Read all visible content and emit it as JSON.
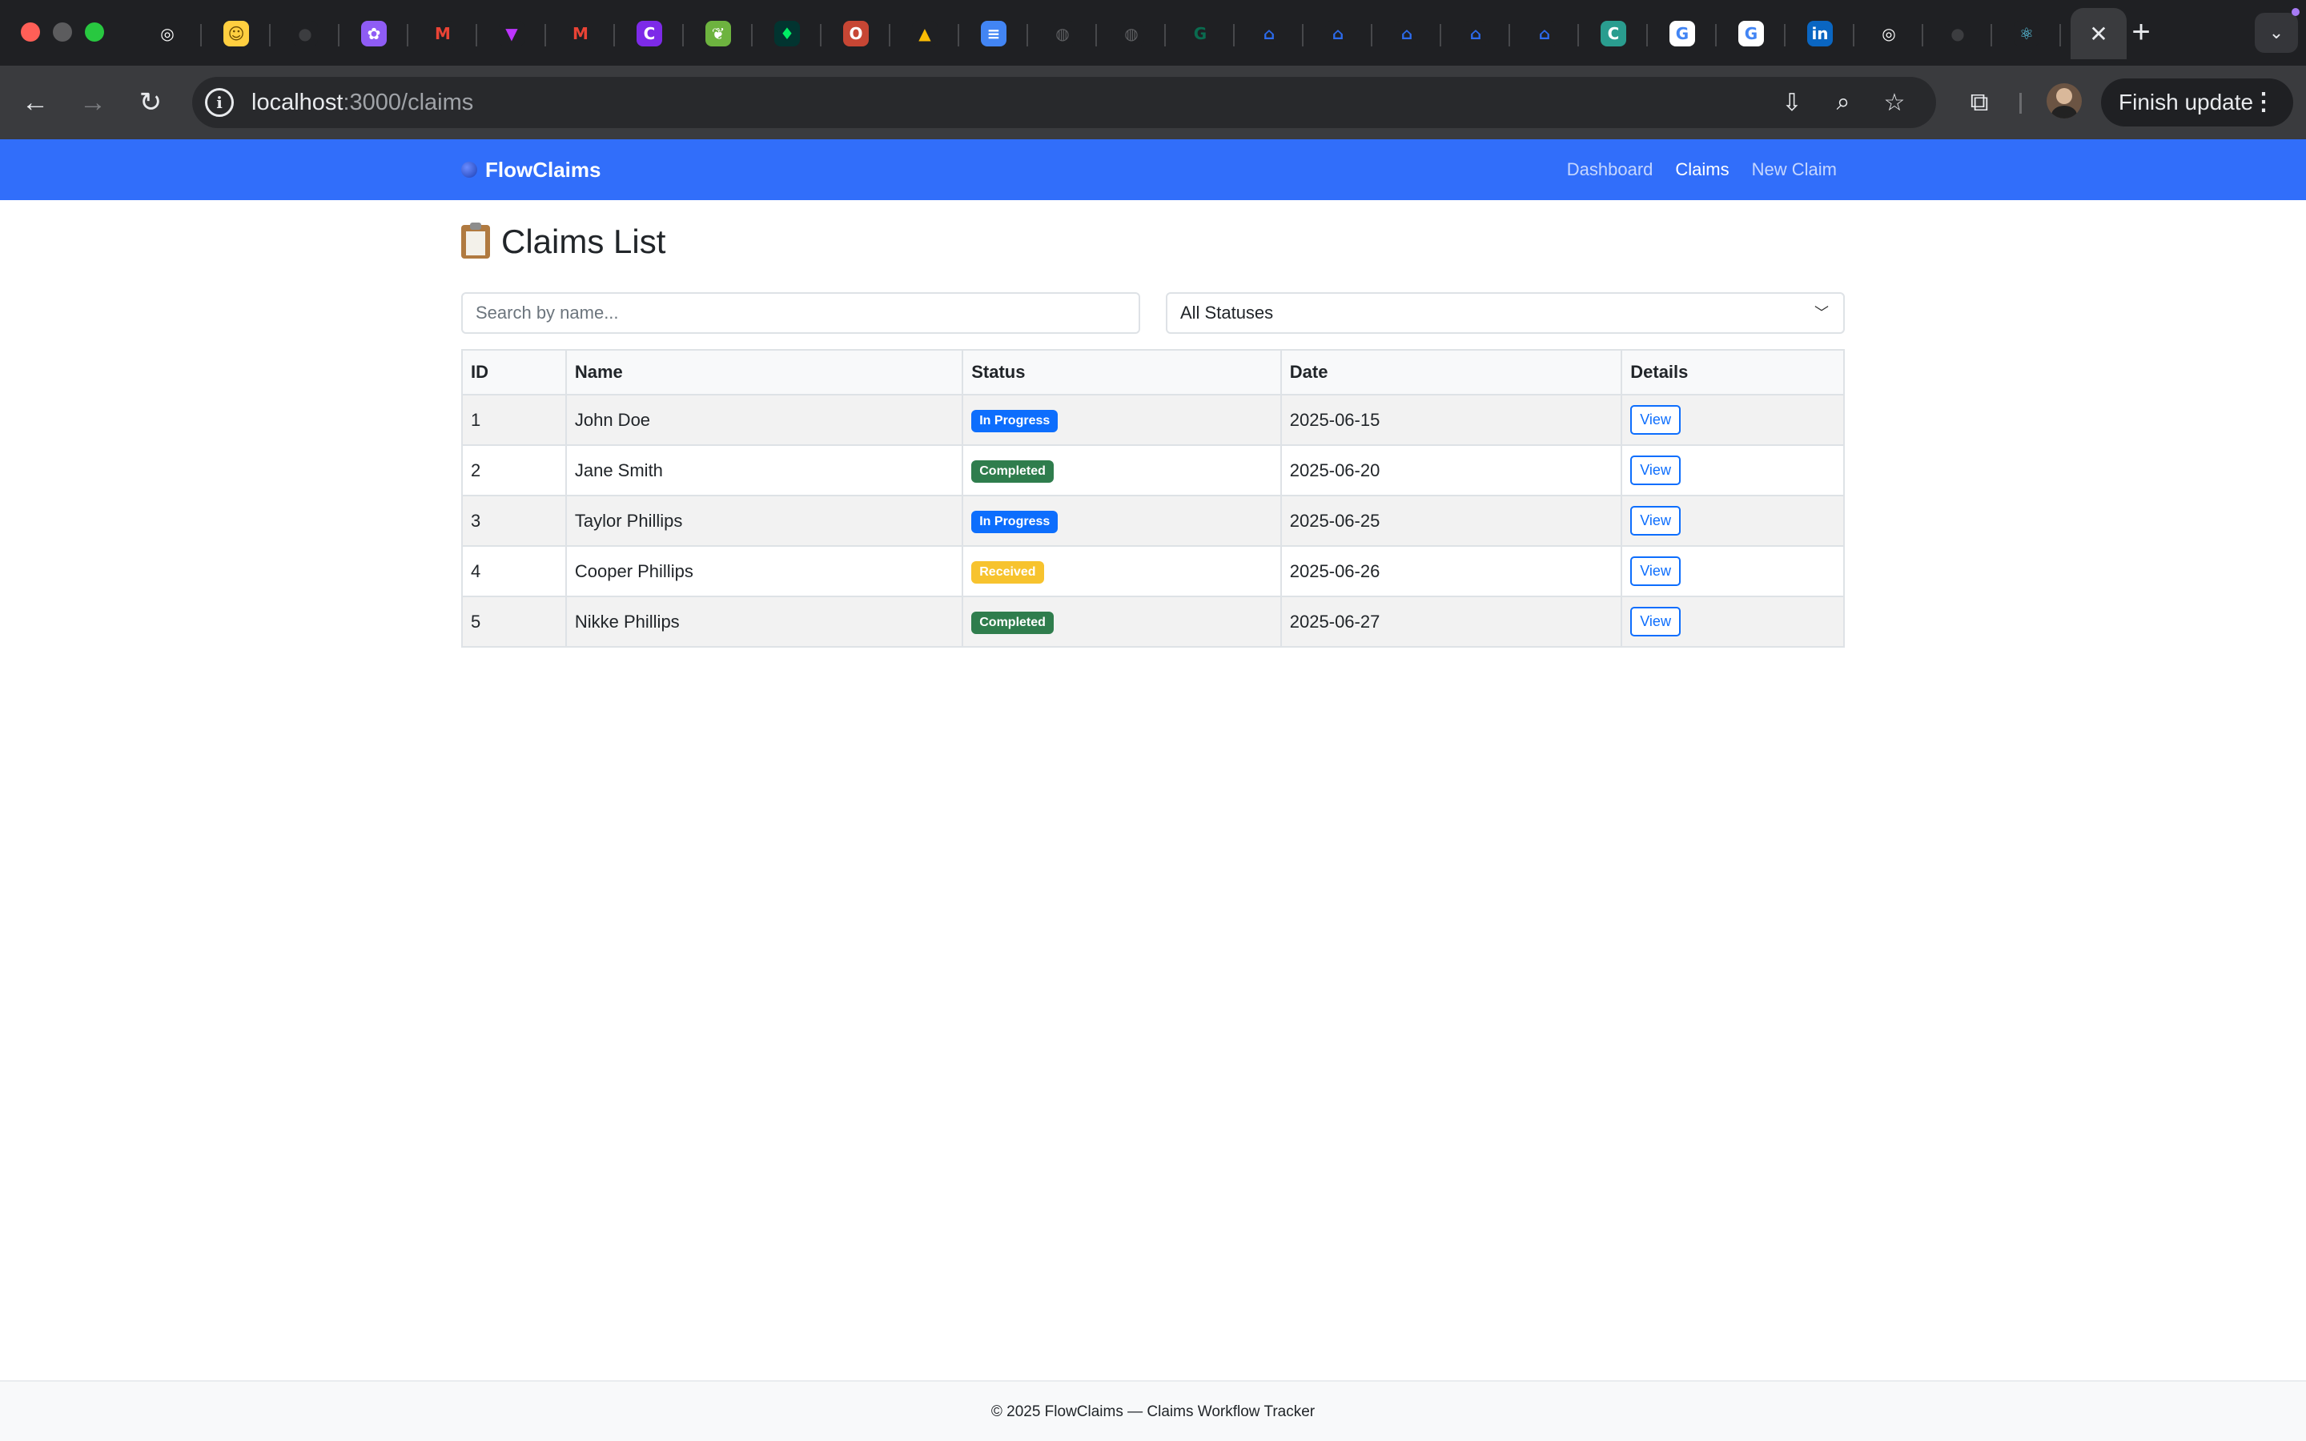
{
  "browser": {
    "tabs": [
      {
        "icon": "openai-icon",
        "glyph": "◎",
        "bg": "#1f2023",
        "fg": "#ffffff"
      },
      {
        "icon": "huggingface-icon",
        "glyph": "☺",
        "bg": "#ffcf40",
        "fg": "#6b4a00"
      },
      {
        "icon": "github-icon",
        "glyph": "●",
        "bg": "#1f2023",
        "fg": "#3c3d40"
      },
      {
        "icon": "figjam-icon",
        "glyph": "✿",
        "bg": "#8f5cf5",
        "fg": "#ffffff"
      },
      {
        "icon": "gmail-icon",
        "glyph": "M",
        "bg": "#1f2023",
        "fg": "#ea4335"
      },
      {
        "icon": "vite-icon",
        "glyph": "▼",
        "bg": "#1f2023",
        "fg": "#bd34fe"
      },
      {
        "icon": "gmail-icon",
        "glyph": "M",
        "bg": "#1f2023",
        "fg": "#ea4335"
      },
      {
        "icon": "canva-icon",
        "glyph": "C",
        "bg": "#7d2ae8",
        "fg": "#ffffff"
      },
      {
        "icon": "spring-icon",
        "glyph": "❦",
        "bg": "#6db33f",
        "fg": "#ffffff"
      },
      {
        "icon": "mongodb-icon",
        "glyph": "♦",
        "bg": "#023430",
        "fg": "#00ed64"
      },
      {
        "icon": "oracle-icon",
        "glyph": "O",
        "bg": "#c74634",
        "fg": "#ffffff"
      },
      {
        "icon": "google-drive-icon",
        "glyph": "▲",
        "bg": "#1f2023",
        "fg": "#fbbc04"
      },
      {
        "icon": "google-docs-icon",
        "glyph": "≡",
        "bg": "#4285f4",
        "fg": "#ffffff"
      },
      {
        "icon": "globe-icon",
        "glyph": "◍",
        "bg": "#1f2023",
        "fg": "#5f6063"
      },
      {
        "icon": "globe-icon",
        "glyph": "◍",
        "bg": "#1f2023",
        "fg": "#5f6063"
      },
      {
        "icon": "loading-icon",
        "glyph": "G",
        "bg": "#1f2023",
        "fg": "#0a6b4f"
      },
      {
        "icon": "zillow-icon",
        "glyph": "⌂",
        "bg": "#1f2023",
        "fg": "#2c6bed"
      },
      {
        "icon": "zillow-icon",
        "glyph": "⌂",
        "bg": "#1f2023",
        "fg": "#2c6bed"
      },
      {
        "icon": "zillow-icon",
        "glyph": "⌂",
        "bg": "#1f2023",
        "fg": "#2c6bed"
      },
      {
        "icon": "zillow-icon",
        "glyph": "⌂",
        "bg": "#1f2023",
        "fg": "#2c6bed"
      },
      {
        "icon": "zillow-icon",
        "glyph": "⌂",
        "bg": "#1f2023",
        "fg": "#2c6bed"
      },
      {
        "icon": "coursera-icon",
        "glyph": "C",
        "bg": "#2a9d8f",
        "fg": "#ffffff"
      },
      {
        "icon": "google-icon",
        "glyph": "G",
        "bg": "#ffffff",
        "fg": "#4285f4"
      },
      {
        "icon": "google-icon",
        "glyph": "G",
        "bg": "#ffffff",
        "fg": "#4285f4"
      },
      {
        "icon": "linkedin-icon",
        "glyph": "in",
        "bg": "#0a66c2",
        "fg": "#ffffff"
      },
      {
        "icon": "openai-icon",
        "glyph": "◎",
        "bg": "#1f2023",
        "fg": "#ffffff"
      },
      {
        "icon": "github-icon",
        "glyph": "●",
        "bg": "#1f2023",
        "fg": "#3c3d40"
      },
      {
        "icon": "react-icon",
        "glyph": "⚛",
        "bg": "#1f2023",
        "fg": "#61dafb"
      }
    ],
    "url_host": "localhost",
    "url_path": ":3000/claims",
    "finish_update_label": "Finish update"
  },
  "app": {
    "brand": "FlowClaims",
    "nav": {
      "dashboard": "Dashboard",
      "claims": "Claims",
      "new_claim": "New Claim"
    },
    "title": "Claims List",
    "search_placeholder": "Search by name...",
    "status_filter": "All Statuses",
    "table": {
      "headers": [
        "ID",
        "Name",
        "Status",
        "Date",
        "Details"
      ],
      "rows": [
        {
          "id": "1",
          "name": "John Doe",
          "status": "In Progress",
          "status_color": "#0d6efd",
          "status_text_color": "#ffffff",
          "date": "2025-06-15",
          "action": "View"
        },
        {
          "id": "2",
          "name": "Jane Smith",
          "status": "Completed",
          "status_color": "#2f7d4d",
          "status_text_color": "#ffffff",
          "date": "2025-06-20",
          "action": "View"
        },
        {
          "id": "3",
          "name": "Taylor Phillips",
          "status": "In Progress",
          "status_color": "#0d6efd",
          "status_text_color": "#ffffff",
          "date": "2025-06-25",
          "action": "View"
        },
        {
          "id": "4",
          "name": "Cooper Phillips",
          "status": "Received",
          "status_color": "#f7c32e",
          "status_text_color": "#ffffff",
          "date": "2025-06-26",
          "action": "View"
        },
        {
          "id": "5",
          "name": "Nikke Phillips",
          "status": "Completed",
          "status_color": "#2f7d4d",
          "status_text_color": "#ffffff",
          "date": "2025-06-27",
          "action": "View"
        }
      ]
    },
    "footer": "© 2025 FlowClaims — Claims Workflow Tracker"
  },
  "colors": {
    "navbar": "#316efa",
    "browser_frame": "#1f2023",
    "toolbar": "#3a3b3e"
  }
}
